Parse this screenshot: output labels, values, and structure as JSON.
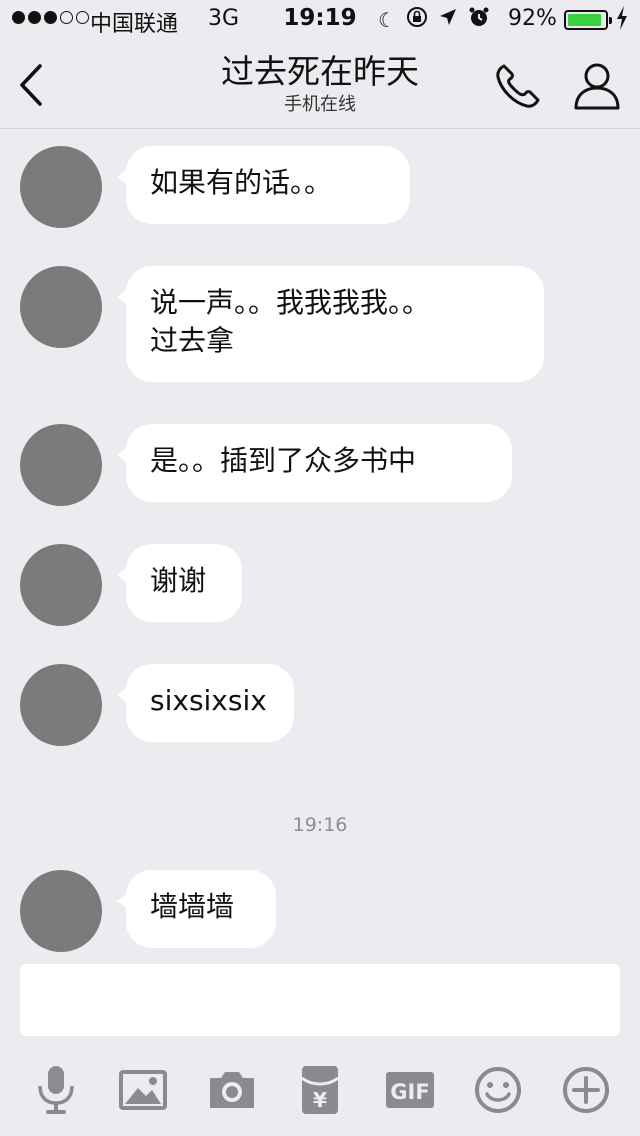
{
  "status_bar": {
    "signal_bars_filled": 3,
    "signal_bars_total": 5,
    "carrier": "中国联通",
    "network": "3G",
    "time": "19:19",
    "battery_percent": "92%",
    "battery_level": 0.92,
    "icons": [
      "moon-icon",
      "rotation-lock-icon",
      "location-arrow-icon",
      "alarm-icon",
      "charging-bolt-icon"
    ]
  },
  "header": {
    "title": "过去死在昨天",
    "subtitle": "手机在线",
    "back_icon": "chevron-left-icon",
    "call_icon": "phone-icon",
    "profile_icon": "person-icon"
  },
  "messages": [
    {
      "sender": "other",
      "text": "如果有的话。。"
    },
    {
      "sender": "other",
      "text": "说一声。。我我我我。。\n过去拿"
    },
    {
      "sender": "other",
      "text": "是。。插到了众多书中"
    },
    {
      "sender": "other",
      "text": "谢谢"
    },
    {
      "sender": "other",
      "text": "sixsixsix"
    },
    {
      "sender": "other",
      "text": "墙墙墙"
    }
  ],
  "timestamp": "19:16",
  "input": {
    "value": "",
    "placeholder": ""
  },
  "toolbar": {
    "items": [
      "microphone-icon",
      "image-icon",
      "camera-icon",
      "red-packet-icon",
      "gif-icon",
      "emoji-icon",
      "plus-icon"
    ],
    "gif_label": "GIF",
    "red_packet_label": "¥"
  },
  "colors": {
    "background": "#ececf0",
    "bubble": "#ffffff",
    "battery": "#3bd03f",
    "icon_gray": "#8a8a8f"
  }
}
